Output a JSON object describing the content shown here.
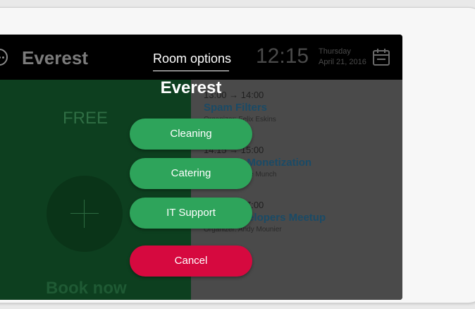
{
  "header": {
    "room_name": "Everest",
    "room_options": "Room options",
    "time": "12:15",
    "day": "Thursday",
    "date": "April 21, 2016"
  },
  "left": {
    "status": "FREE",
    "book_now": "Book now"
  },
  "meetings": [
    {
      "time": "13:00 → 14:00",
      "title": "Spam Filters",
      "organizer": "Organizer: Felix Eskins"
    },
    {
      "time": "14:15 → 15:00",
      "title": "Website Monetization",
      "organizer": "Organizer: Alice Munch"
    },
    {
      "time": "16:00 → 17:00",
      "title": "Web Developers Meetup",
      "organizer": "Organizer: Andy Mounier"
    }
  ],
  "dialog": {
    "title": "Everest",
    "options": [
      "Cleaning",
      "Catering",
      "IT Support"
    ],
    "cancel": "Cancel"
  },
  "colors": {
    "free_green": "#0d3f1f",
    "button_green": "#2ea45b",
    "cancel_red": "#d6093f",
    "meeting_title": "#1a4a66"
  },
  "icons": {
    "menu": "more-horizontal-circle-icon",
    "calendar": "calendar-icon",
    "add": "plus-icon"
  }
}
